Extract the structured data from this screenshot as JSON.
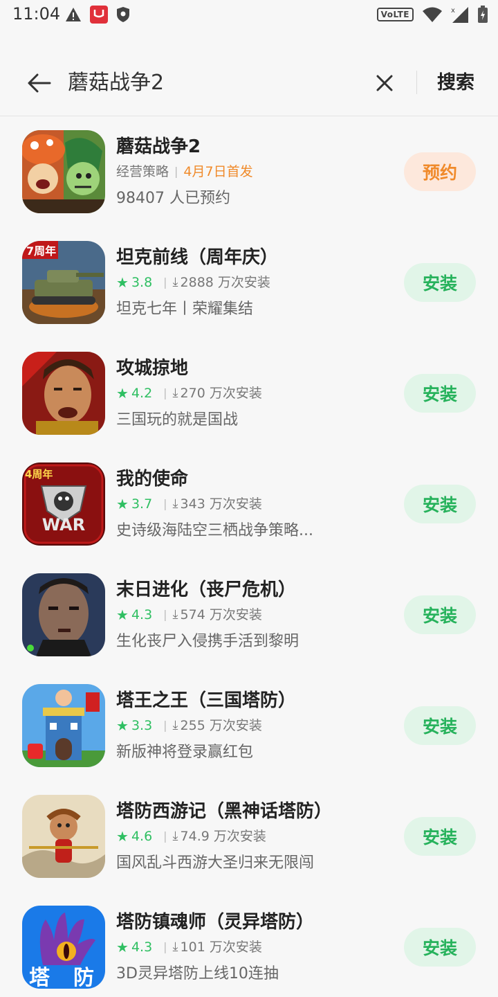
{
  "status_bar": {
    "time": "11:04",
    "network_badge": "VoLTE",
    "icons_left": [
      "warning-icon",
      "app-notification-icon",
      "shield-icon"
    ],
    "icons_right": [
      "wifi-icon",
      "signal-icon",
      "battery-charging-icon"
    ]
  },
  "search": {
    "query": "蘑菇战争2",
    "search_label": "搜索"
  },
  "colors": {
    "green": "#2fbf62",
    "orange": "#f08a2a",
    "install_bg": "#e1f5e8",
    "reserve_bg": "#fde8dc"
  },
  "apps": [
    {
      "name": "蘑菇战争2",
      "category": "经营策略",
      "release": "4月7日首发",
      "desc": "98407 人已预约",
      "action": "预约"
    },
    {
      "name": "坦克前线（周年庆）",
      "rating": "3.8",
      "downloads": "2888 万次安装",
      "desc": "坦克七年丨荣耀集结",
      "action": "安装"
    },
    {
      "name": "攻城掠地",
      "rating": "4.2",
      "downloads": "270 万次安装",
      "desc": "三国玩的就是国战",
      "action": "安装"
    },
    {
      "name": "我的使命",
      "rating": "3.7",
      "downloads": "343 万次安装",
      "desc": "史诗级海陆空三栖战争策略...",
      "action": "安装"
    },
    {
      "name": "末日进化（丧尸危机）",
      "rating": "4.3",
      "downloads": "574 万次安装",
      "desc": "生化丧尸入侵携手活到黎明",
      "action": "安装"
    },
    {
      "name": "塔王之王（三国塔防）",
      "rating": "3.3",
      "downloads": "255 万次安装",
      "desc": "新版神将登录赢红包",
      "action": "安装"
    },
    {
      "name": "塔防西游记（黑神话塔防）",
      "rating": "4.6",
      "downloads": "74.9 万次安装",
      "desc": "国风乱斗西游大圣归来无限闯",
      "action": "安装"
    },
    {
      "name": "塔防镇魂师（灵异塔防）",
      "rating": "4.3",
      "downloads": "101 万次安装",
      "desc": "3D灵异塔防上线10连抽",
      "action": "安装"
    }
  ],
  "icon_text": {
    "tank": "7周年",
    "war_badge": "4周年",
    "war": "WAR",
    "td_1": "塔",
    "td_2": "防"
  }
}
